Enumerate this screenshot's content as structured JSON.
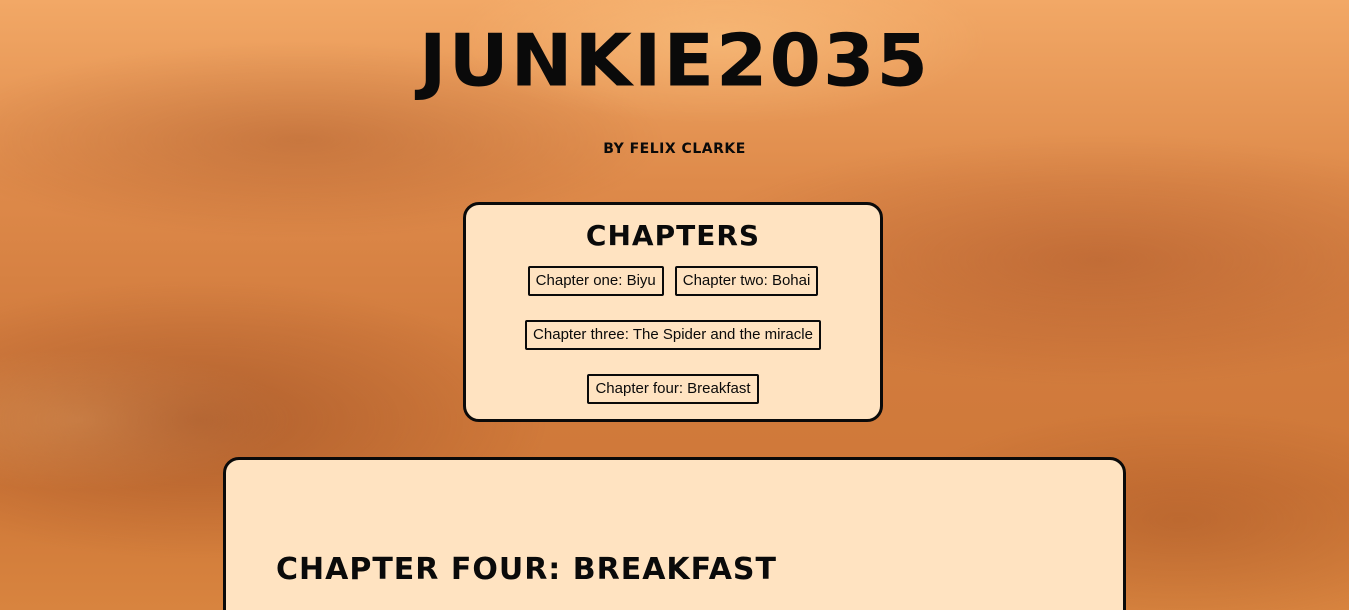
{
  "header": {
    "title": "JUNKIE2035",
    "byline": "BY FELIX CLARKE"
  },
  "chapters_nav": {
    "heading": "CHAPTERS",
    "links": [
      {
        "label": "Chapter one: Biyu"
      },
      {
        "label": "Chapter two: Bohai"
      },
      {
        "label": "Chapter three: The Spider and the miracle"
      },
      {
        "label": "Chapter four: Breakfast"
      }
    ]
  },
  "content": {
    "chapter_title": "CHAPTER FOUR: BREAKFAST"
  },
  "colors": {
    "card_background": "#ffe3c1",
    "text": "#0a0a0a",
    "sky_orange": "#de8a4a"
  }
}
